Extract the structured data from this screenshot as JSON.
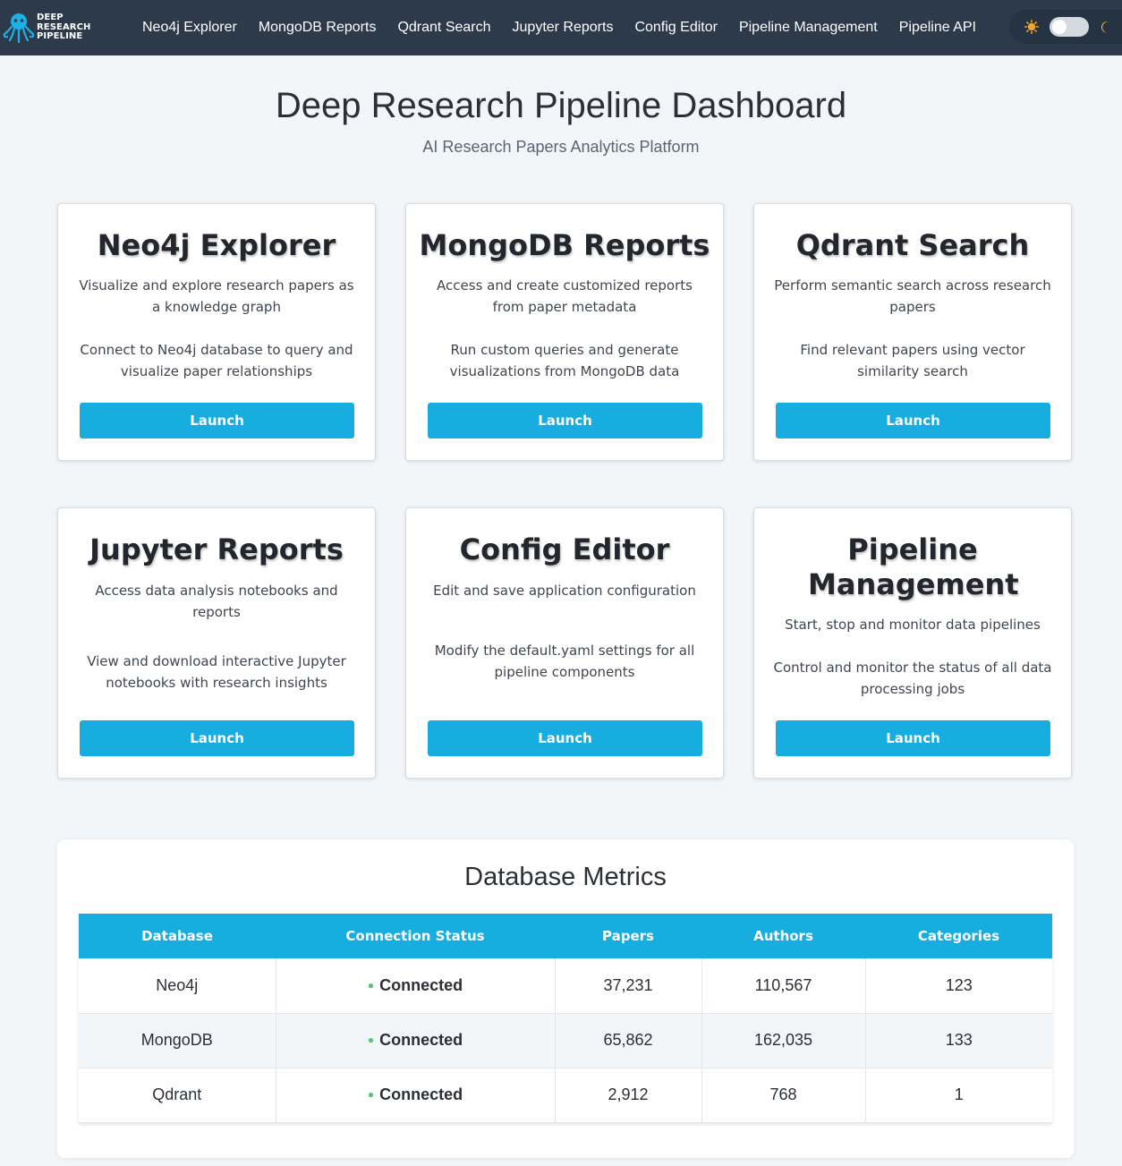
{
  "brand": {
    "line1": "DEEP",
    "line2": "RESEARCH",
    "line3": "PIPELINE"
  },
  "nav": {
    "links": [
      "Neo4j Explorer",
      "MongoDB Reports",
      "Qdrant Search",
      "Jupyter Reports",
      "Config Editor",
      "Pipeline Management",
      "Pipeline API"
    ],
    "theme_toggle": {
      "sun_icon": "sun-icon",
      "moon_icon": "moon-icon",
      "dark_mode": false
    }
  },
  "header": {
    "title": "Deep Research Pipeline Dashboard",
    "subtitle": "AI Research Papers Analytics Platform"
  },
  "cards": [
    {
      "title": "Neo4j Explorer",
      "description": "Visualize and explore research papers as a knowledge graph",
      "detail": "Connect to Neo4j database to query and visualize paper relationships",
      "button": "Launch"
    },
    {
      "title": "MongoDB Reports",
      "description": "Access and create customized reports from paper metadata",
      "detail": "Run custom queries and generate visualizations from MongoDB data",
      "button": "Launch"
    },
    {
      "title": "Qdrant Search",
      "description": "Perform semantic search across research papers",
      "detail": "Find relevant papers using vector similarity search",
      "button": "Launch"
    },
    {
      "title": "Jupyter Reports",
      "description": "Access data analysis notebooks and reports",
      "detail": "View and download interactive Jupyter notebooks with research insights",
      "button": "Launch"
    },
    {
      "title": "Config Editor",
      "description": "Edit and save application configuration",
      "detail": "Modify the default.yaml settings for all pipeline components",
      "button": "Launch"
    },
    {
      "title": "Pipeline Management",
      "description": "Start, stop and monitor data pipelines",
      "detail": "Control and monitor the status of all data processing jobs",
      "button": "Launch"
    }
  ],
  "metrics": {
    "title": "Database Metrics",
    "columns": [
      "Database",
      "Connection Status",
      "Papers",
      "Authors",
      "Categories"
    ],
    "rows": [
      {
        "database": "Neo4j",
        "status": "Connected",
        "papers": "37,231",
        "authors": "110,567",
        "categories": "123"
      },
      {
        "database": "MongoDB",
        "status": "Connected",
        "papers": "65,862",
        "authors": "162,035",
        "categories": "133"
      },
      {
        "database": "Qdrant",
        "status": "Connected",
        "papers": "2,912",
        "authors": "768",
        "categories": "1"
      }
    ]
  },
  "colors": {
    "navbar": "#2c3a4b",
    "accent": "#17ade0",
    "background": "#f3f6f9",
    "status_connected": "#27a84e"
  }
}
